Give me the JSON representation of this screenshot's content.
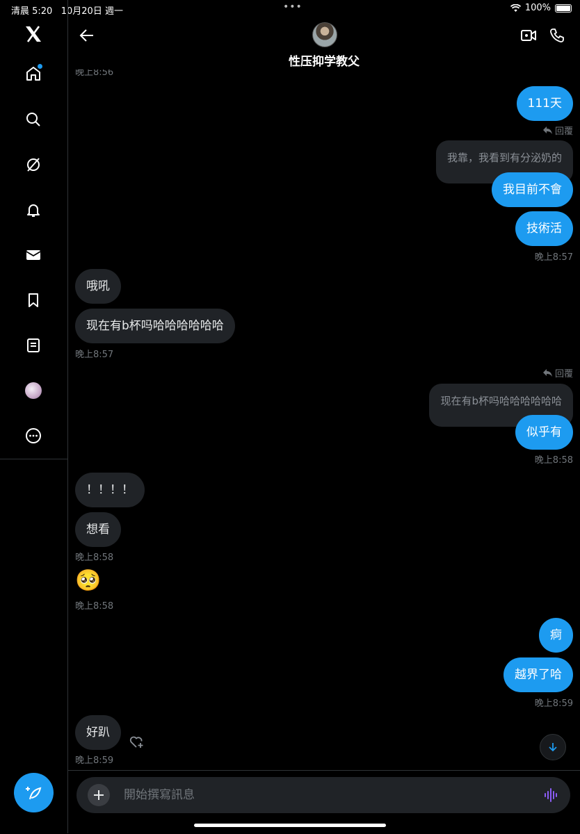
{
  "status": {
    "time": "清晨 5:20",
    "date": "10月20日 週一",
    "dots": "•••",
    "battery": "100%"
  },
  "header": {
    "name": "性压抑学教父"
  },
  "chat": {
    "top_cut_time": "晚上8:56",
    "messages": [
      {
        "side": "out",
        "text": "111天"
      },
      {
        "side": "out",
        "reply_label": "回覆",
        "quote": "我靠，我看到有分泌奶的",
        "text": "我目前不會"
      },
      {
        "side": "out",
        "text": "技術活",
        "time": "晚上8:57"
      },
      {
        "side": "in",
        "text": "哦吼"
      },
      {
        "side": "in",
        "text": "现在有b杯吗哈哈哈哈哈哈",
        "time": "晚上8:57"
      },
      {
        "side": "out",
        "reply_label": "回覆",
        "quote": "现在有b杯吗哈哈哈哈哈哈",
        "text": "似乎有",
        "time": "晚上8:58"
      },
      {
        "side": "in",
        "text": "！！！！"
      },
      {
        "side": "in",
        "text": "想看",
        "time": "晚上8:58"
      },
      {
        "side": "in",
        "emoji": "🥺",
        "time": "晚上8:58"
      },
      {
        "side": "out",
        "text": "痾"
      },
      {
        "side": "out",
        "text": "越界了哈",
        "time": "晚上8:59"
      },
      {
        "side": "in",
        "text": "好趴",
        "time": "晚上8:59"
      }
    ]
  },
  "composer": {
    "placeholder": "開始撰寫訊息"
  },
  "icons": {
    "sidebar": [
      "x-logo-icon",
      "home-icon",
      "search-icon",
      "grok-icon",
      "bell-icon",
      "mail-icon",
      "bookmark-icon",
      "lists-icon",
      "profile-avatar",
      "more-icon"
    ],
    "compose": "feather-plus-icon",
    "header": [
      "back-arrow-icon",
      "video-call-icon",
      "phone-icon"
    ]
  },
  "colors": {
    "accent": "#1d9bf0",
    "bubble_in": "#202327",
    "background": "#000000",
    "muted": "#71767b"
  }
}
